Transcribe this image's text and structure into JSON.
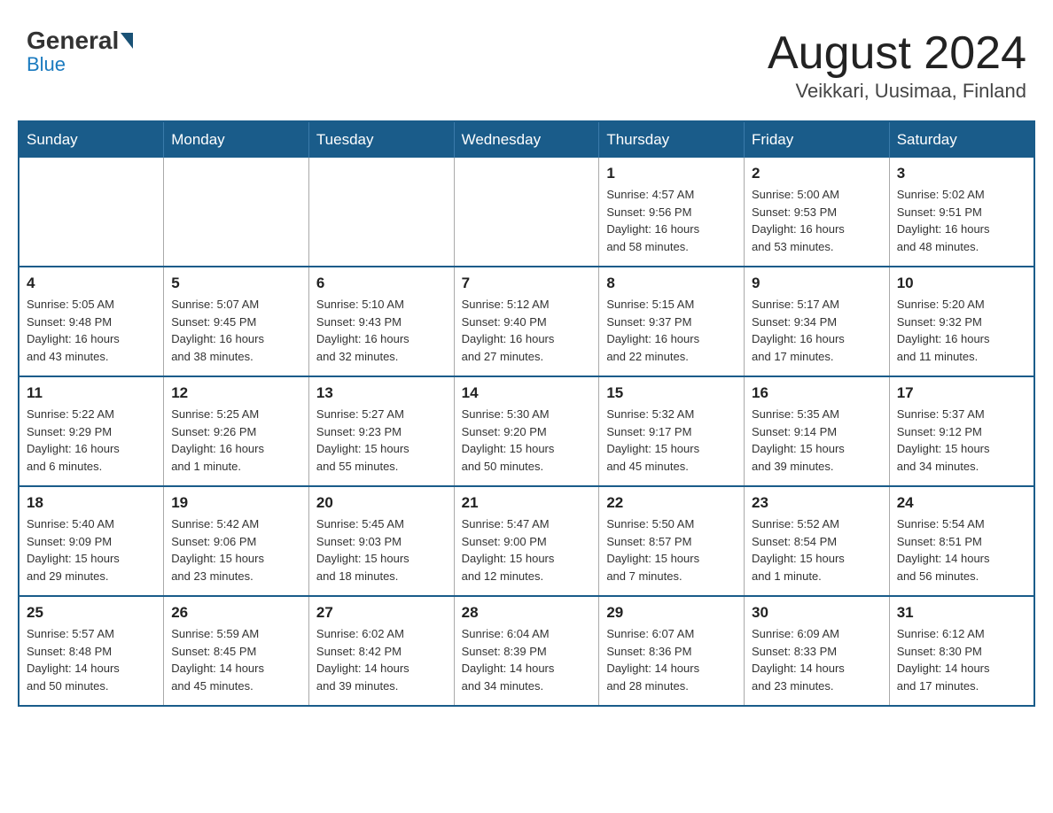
{
  "header": {
    "logo_general": "General",
    "logo_blue": "Blue",
    "month_title": "August 2024",
    "location": "Veikkari, Uusimaa, Finland"
  },
  "weekdays": [
    "Sunday",
    "Monday",
    "Tuesday",
    "Wednesday",
    "Thursday",
    "Friday",
    "Saturday"
  ],
  "weeks": [
    [
      {
        "day": "",
        "info": ""
      },
      {
        "day": "",
        "info": ""
      },
      {
        "day": "",
        "info": ""
      },
      {
        "day": "",
        "info": ""
      },
      {
        "day": "1",
        "info": "Sunrise: 4:57 AM\nSunset: 9:56 PM\nDaylight: 16 hours\nand 58 minutes."
      },
      {
        "day": "2",
        "info": "Sunrise: 5:00 AM\nSunset: 9:53 PM\nDaylight: 16 hours\nand 53 minutes."
      },
      {
        "day": "3",
        "info": "Sunrise: 5:02 AM\nSunset: 9:51 PM\nDaylight: 16 hours\nand 48 minutes."
      }
    ],
    [
      {
        "day": "4",
        "info": "Sunrise: 5:05 AM\nSunset: 9:48 PM\nDaylight: 16 hours\nand 43 minutes."
      },
      {
        "day": "5",
        "info": "Sunrise: 5:07 AM\nSunset: 9:45 PM\nDaylight: 16 hours\nand 38 minutes."
      },
      {
        "day": "6",
        "info": "Sunrise: 5:10 AM\nSunset: 9:43 PM\nDaylight: 16 hours\nand 32 minutes."
      },
      {
        "day": "7",
        "info": "Sunrise: 5:12 AM\nSunset: 9:40 PM\nDaylight: 16 hours\nand 27 minutes."
      },
      {
        "day": "8",
        "info": "Sunrise: 5:15 AM\nSunset: 9:37 PM\nDaylight: 16 hours\nand 22 minutes."
      },
      {
        "day": "9",
        "info": "Sunrise: 5:17 AM\nSunset: 9:34 PM\nDaylight: 16 hours\nand 17 minutes."
      },
      {
        "day": "10",
        "info": "Sunrise: 5:20 AM\nSunset: 9:32 PM\nDaylight: 16 hours\nand 11 minutes."
      }
    ],
    [
      {
        "day": "11",
        "info": "Sunrise: 5:22 AM\nSunset: 9:29 PM\nDaylight: 16 hours\nand 6 minutes."
      },
      {
        "day": "12",
        "info": "Sunrise: 5:25 AM\nSunset: 9:26 PM\nDaylight: 16 hours\nand 1 minute."
      },
      {
        "day": "13",
        "info": "Sunrise: 5:27 AM\nSunset: 9:23 PM\nDaylight: 15 hours\nand 55 minutes."
      },
      {
        "day": "14",
        "info": "Sunrise: 5:30 AM\nSunset: 9:20 PM\nDaylight: 15 hours\nand 50 minutes."
      },
      {
        "day": "15",
        "info": "Sunrise: 5:32 AM\nSunset: 9:17 PM\nDaylight: 15 hours\nand 45 minutes."
      },
      {
        "day": "16",
        "info": "Sunrise: 5:35 AM\nSunset: 9:14 PM\nDaylight: 15 hours\nand 39 minutes."
      },
      {
        "day": "17",
        "info": "Sunrise: 5:37 AM\nSunset: 9:12 PM\nDaylight: 15 hours\nand 34 minutes."
      }
    ],
    [
      {
        "day": "18",
        "info": "Sunrise: 5:40 AM\nSunset: 9:09 PM\nDaylight: 15 hours\nand 29 minutes."
      },
      {
        "day": "19",
        "info": "Sunrise: 5:42 AM\nSunset: 9:06 PM\nDaylight: 15 hours\nand 23 minutes."
      },
      {
        "day": "20",
        "info": "Sunrise: 5:45 AM\nSunset: 9:03 PM\nDaylight: 15 hours\nand 18 minutes."
      },
      {
        "day": "21",
        "info": "Sunrise: 5:47 AM\nSunset: 9:00 PM\nDaylight: 15 hours\nand 12 minutes."
      },
      {
        "day": "22",
        "info": "Sunrise: 5:50 AM\nSunset: 8:57 PM\nDaylight: 15 hours\nand 7 minutes."
      },
      {
        "day": "23",
        "info": "Sunrise: 5:52 AM\nSunset: 8:54 PM\nDaylight: 15 hours\nand 1 minute."
      },
      {
        "day": "24",
        "info": "Sunrise: 5:54 AM\nSunset: 8:51 PM\nDaylight: 14 hours\nand 56 minutes."
      }
    ],
    [
      {
        "day": "25",
        "info": "Sunrise: 5:57 AM\nSunset: 8:48 PM\nDaylight: 14 hours\nand 50 minutes."
      },
      {
        "day": "26",
        "info": "Sunrise: 5:59 AM\nSunset: 8:45 PM\nDaylight: 14 hours\nand 45 minutes."
      },
      {
        "day": "27",
        "info": "Sunrise: 6:02 AM\nSunset: 8:42 PM\nDaylight: 14 hours\nand 39 minutes."
      },
      {
        "day": "28",
        "info": "Sunrise: 6:04 AM\nSunset: 8:39 PM\nDaylight: 14 hours\nand 34 minutes."
      },
      {
        "day": "29",
        "info": "Sunrise: 6:07 AM\nSunset: 8:36 PM\nDaylight: 14 hours\nand 28 minutes."
      },
      {
        "day": "30",
        "info": "Sunrise: 6:09 AM\nSunset: 8:33 PM\nDaylight: 14 hours\nand 23 minutes."
      },
      {
        "day": "31",
        "info": "Sunrise: 6:12 AM\nSunset: 8:30 PM\nDaylight: 14 hours\nand 17 minutes."
      }
    ]
  ]
}
